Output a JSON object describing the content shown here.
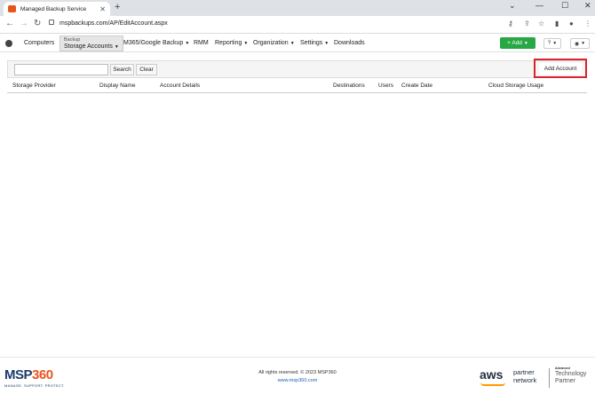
{
  "browser": {
    "tab_title": "Managed Backup Service",
    "url": "mspbackups.com/AP/EditAccount.aspx"
  },
  "nav": {
    "computers": "Computers",
    "backup_small": "Backup",
    "storage_accounts": "Storage Accounts",
    "m365": "M365/Google Backup",
    "rmm": "RMM",
    "reporting": "Reporting",
    "organization": "Organization",
    "settings": "Settings",
    "downloads": "Downloads",
    "add": "+ Add"
  },
  "toolbar": {
    "search_value": "",
    "search_label": "Search",
    "clear_label": "Clear",
    "add_account_label": "Add Account"
  },
  "table": {
    "columns": [
      "Storage Provider",
      "Display Name",
      "Account Details",
      "Destinations",
      "Users",
      "Create Date",
      "Cloud Storage Usage"
    ]
  },
  "footer": {
    "brand": "MSP",
    "brand_num": "360",
    "tagline": "MANAGE. SUPPORT. PROTECT.",
    "copyright": "All rights reserved. © 2023 MSP360",
    "website": "www.msp360.com",
    "aws": "aws",
    "partner": "partner",
    "network": "network",
    "advanced": "Advanced",
    "technology": "Technology",
    "partner2": "Partner"
  },
  "colors": {
    "add_button": "#28a745",
    "highlight_box": "#d9232d",
    "brand_orange": "#e8541c",
    "brand_navy": "#1b3a6b"
  }
}
